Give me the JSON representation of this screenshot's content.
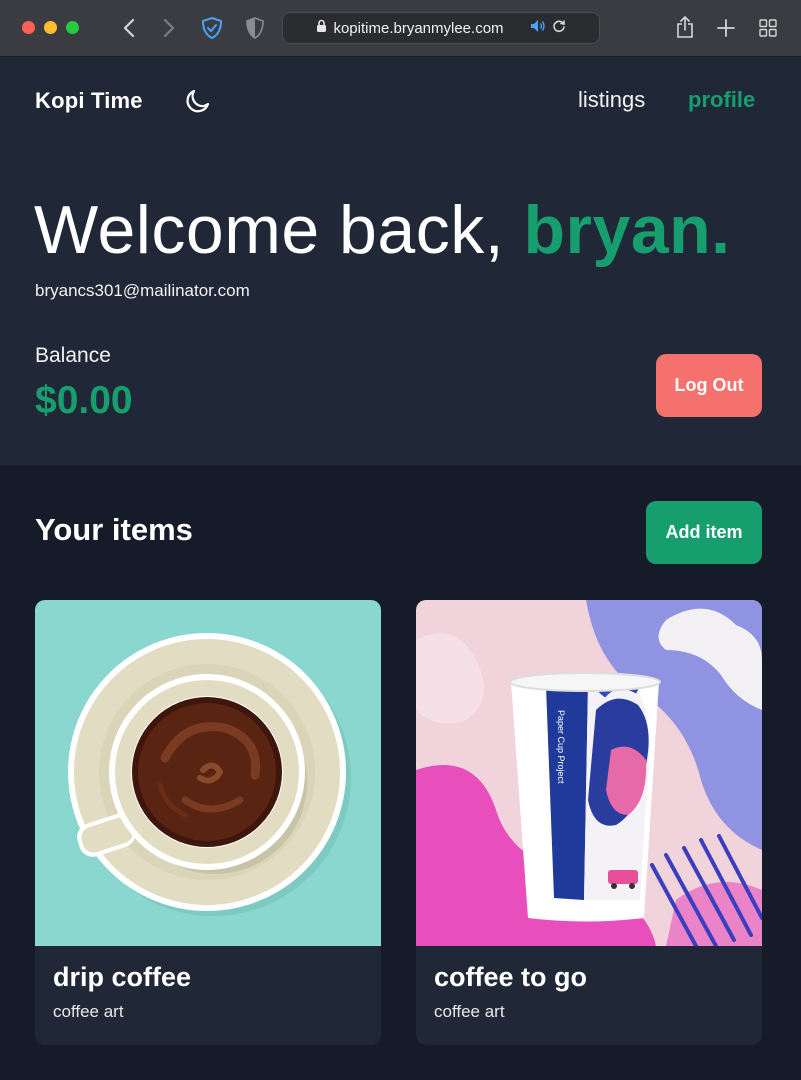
{
  "browser": {
    "url": "kopitime.bryanmylee.com"
  },
  "header": {
    "brand": "Kopi Time",
    "nav": {
      "listings": "listings",
      "profile": "profile"
    }
  },
  "profile": {
    "greeting": "Welcome back,",
    "name": "bryan.",
    "email": "bryancs301@mailinator.com",
    "balance_label": "Balance",
    "balance_value": "$0.00",
    "logout_label": "Log Out"
  },
  "items": {
    "title": "Your items",
    "add_label": "Add item",
    "list": [
      {
        "name": "drip coffee",
        "category": "coffee art"
      },
      {
        "name": "coffee to go",
        "category": "coffee art"
      }
    ],
    "cup_print": "Paper Cup Project"
  },
  "colors": {
    "accent": "#169e6e",
    "danger": "#f4716d",
    "panel": "#202838",
    "background": "#151b29"
  }
}
